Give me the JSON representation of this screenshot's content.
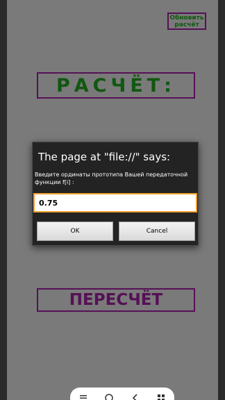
{
  "page": {
    "refresh_label": "Обновить расчёт",
    "title": "РАСЧЁТ:",
    "recalc_label": "ПЕРЕСЧЁТ"
  },
  "dialog": {
    "title": "The page at \"file://\" says:",
    "message": "Введите ординаты прототипа Вашей передаточной  функции f[i] :",
    "input_value": "0.75",
    "ok_label": "OK",
    "cancel_label": "Cancel"
  },
  "navbar": {
    "icons": [
      "menu-icon",
      "home-icon",
      "back-icon",
      "apps-icon"
    ]
  },
  "colors": {
    "green_text": "#1c8f1c",
    "purple_accent": "#8b1b8b",
    "input_border": "#f0a030"
  }
}
